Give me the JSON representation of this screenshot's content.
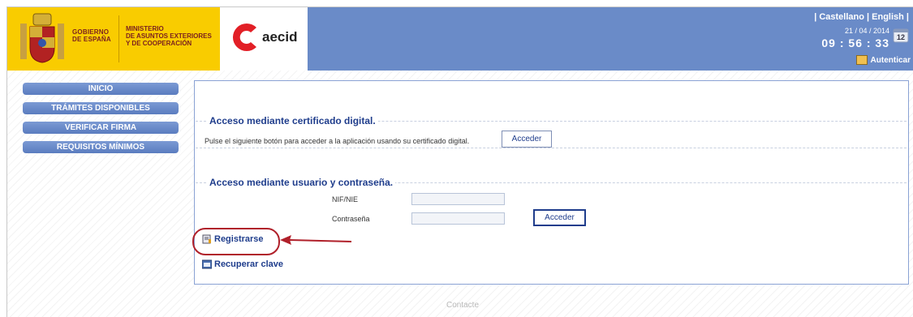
{
  "header": {
    "gobierno_lines": [
      "GOBIERNO",
      "DE ESPAÑA"
    ],
    "ministerio_lines": [
      "MINISTERIO",
      "DE ASUNTOS EXTERIORES",
      "Y DE COOPERACIÓN"
    ],
    "brand": "aecid",
    "language_bar": "| Castellano | English |",
    "date": "21 / 04 / 2014",
    "time": "09 : 56 : 33",
    "calendar_day": "12",
    "auth_label": "Autenticar",
    "colors": {
      "header_blue": "#6a8bc8",
      "logo_yellow": "#f9cc00",
      "aecid_red": "#e21f26"
    }
  },
  "menu": {
    "items": [
      {
        "label": "INICIO"
      },
      {
        "label": "TRÁMITES DISPONIBLES"
      },
      {
        "label": "VERIFICAR FIRMA"
      },
      {
        "label": "REQUISITOS MÍNIMOS"
      }
    ]
  },
  "cert_section": {
    "legend": "Acceso mediante certificado digital.",
    "text": "Pulse el siguiente botón para acceder a la aplicación usando su certificado digital.",
    "button": "Acceder"
  },
  "user_section": {
    "legend": "Acceso mediante usuario y contraseña.",
    "nif_label": "NIF/NIE",
    "nif_value": "",
    "password_label": "Contraseña",
    "password_value": "",
    "button": "Acceder"
  },
  "links": {
    "register": "Registrarse",
    "register_icon": "register-icon",
    "recover": "Recuperar clave",
    "recover_icon": "key-recover-icon"
  },
  "footer": {
    "contact": "Contacte"
  }
}
